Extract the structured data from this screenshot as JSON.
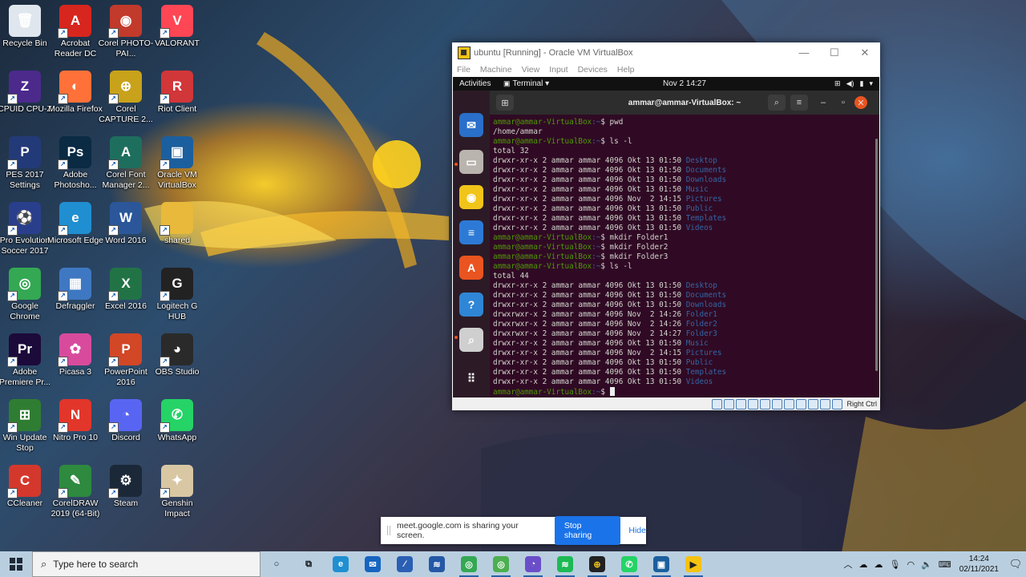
{
  "desktop_icons": [
    {
      "label": "Recycle Bin",
      "icon": "recycle-bin-icon",
      "color": "#dfe6ee",
      "glyph": "🗑"
    },
    {
      "label": "Acrobat Reader DC",
      "icon": "acrobat-icon",
      "color": "#d7261e",
      "glyph": "A"
    },
    {
      "label": "Corel PHOTO-PAI...",
      "icon": "corel-photopaint-icon",
      "color": "#c23a2b",
      "glyph": "◉"
    },
    {
      "label": "VALORANT",
      "icon": "valorant-icon",
      "color": "#ff4655",
      "glyph": "V"
    },
    {
      "label": "CPUID CPU-Z",
      "icon": "cpuz-icon",
      "color": "#4b2a8c",
      "glyph": "Z"
    },
    {
      "label": "Mozilla Firefox",
      "icon": "firefox-icon",
      "color": "#ff7139",
      "glyph": "◐"
    },
    {
      "label": "Corel CAPTURE 2...",
      "icon": "corel-capture-icon",
      "color": "#c8a21a",
      "glyph": "⊕"
    },
    {
      "label": "Riot Client",
      "icon": "riot-client-icon",
      "color": "#d13639",
      "glyph": "R"
    },
    {
      "label": "PES 2017 Settings",
      "icon": "pes-settings-icon",
      "color": "#233a78",
      "glyph": "P"
    },
    {
      "label": "Adobe Photosho...",
      "icon": "photoshop-icon",
      "color": "#0b2a43",
      "glyph": "Ps"
    },
    {
      "label": "Corel Font Manager 2...",
      "icon": "corel-font-manager-icon",
      "color": "#1e6e5e",
      "glyph": "A"
    },
    {
      "label": "Oracle VM VirtualBox",
      "icon": "virtualbox-icon",
      "color": "#1c5f9e",
      "glyph": "▣"
    },
    {
      "label": "Pro Evolution Soccer 2017",
      "icon": "pes-icon",
      "color": "#2a3f8c",
      "glyph": "⚽"
    },
    {
      "label": "Microsoft Edge",
      "icon": "edge-icon",
      "color": "#1f8fd1",
      "glyph": "e"
    },
    {
      "label": "Word 2016",
      "icon": "word-icon",
      "color": "#2b579a",
      "glyph": "W"
    },
    {
      "label": "shared",
      "icon": "folder-icon",
      "color": "#e8b93a",
      "glyph": ""
    },
    {
      "label": "Google Chrome",
      "icon": "chrome-icon",
      "color": "#34a853",
      "glyph": "◎"
    },
    {
      "label": "Defraggler",
      "icon": "defraggler-icon",
      "color": "#3f78c2",
      "glyph": "▦"
    },
    {
      "label": "Excel 2016",
      "icon": "excel-icon",
      "color": "#217346",
      "glyph": "X"
    },
    {
      "label": "Logitech G HUB",
      "icon": "logitech-ghub-icon",
      "color": "#222222",
      "glyph": "G"
    },
    {
      "label": "Adobe Premiere Pr...",
      "icon": "premiere-icon",
      "color": "#1c0a3a",
      "glyph": "Pr"
    },
    {
      "label": "Picasa 3",
      "icon": "picasa-icon",
      "color": "#d84b9c",
      "glyph": "✿"
    },
    {
      "label": "PowerPoint 2016",
      "icon": "powerpoint-icon",
      "color": "#d24726",
      "glyph": "P"
    },
    {
      "label": "OBS Studio",
      "icon": "obs-icon",
      "color": "#2a2a2a",
      "glyph": "◕"
    },
    {
      "label": "Win Update Stop",
      "icon": "win-update-stop-icon",
      "color": "#2f7d32",
      "glyph": "⊞"
    },
    {
      "label": "Nitro Pro 10",
      "icon": "nitro-icon",
      "color": "#e2362b",
      "glyph": "N"
    },
    {
      "label": "Discord",
      "icon": "discord-icon",
      "color": "#5865f2",
      "glyph": "◔"
    },
    {
      "label": "WhatsApp",
      "icon": "whatsapp-icon",
      "color": "#25d366",
      "glyph": "✆"
    },
    {
      "label": "CCleaner",
      "icon": "ccleaner-icon",
      "color": "#d4382c",
      "glyph": "C"
    },
    {
      "label": "CorelDRAW 2019 (64-Bit)",
      "icon": "coreldraw-icon",
      "color": "#2d8a3e",
      "glyph": "✎"
    },
    {
      "label": "Steam",
      "icon": "steam-icon",
      "color": "#1b2838",
      "glyph": "⚙"
    },
    {
      "label": "Genshin Impact",
      "icon": "genshin-icon",
      "color": "#d9c7a3",
      "glyph": "✦"
    }
  ],
  "vbox": {
    "title": "ubuntu [Running] - Oracle VM VirtualBox",
    "menu": [
      "File",
      "Machine",
      "View",
      "Input",
      "Devices",
      "Help"
    ],
    "status_key": "Right Ctrl"
  },
  "gnome": {
    "activities": "Activities",
    "app": "Terminal ▾",
    "clock": "Nov 2  14:27"
  },
  "terminal": {
    "title": "ammar@ammar-VirtualBox: ~",
    "prompt_user": "ammar@ammar-VirtualBox",
    "prompt_path": ":~",
    "lines": [
      {
        "kind": "cmd",
        "text": "$ pwd"
      },
      {
        "kind": "out",
        "text": "/home/ammar"
      },
      {
        "kind": "cmd",
        "text": "$ ls -l"
      },
      {
        "kind": "out",
        "text": "total 32"
      },
      {
        "kind": "ls",
        "text": "drwxr-xr-x 2 ammar ammar 4096 Okt 13 01:50 ",
        "name": "Desktop"
      },
      {
        "kind": "ls",
        "text": "drwxr-xr-x 2 ammar ammar 4096 Okt 13 01:50 ",
        "name": "Documents"
      },
      {
        "kind": "ls",
        "text": "drwxr-xr-x 2 ammar ammar 4096 Okt 13 01:50 ",
        "name": "Downloads"
      },
      {
        "kind": "ls",
        "text": "drwxr-xr-x 2 ammar ammar 4096 Okt 13 01:50 ",
        "name": "Music"
      },
      {
        "kind": "ls",
        "text": "drwxr-xr-x 2 ammar ammar 4096 Nov  2 14:15 ",
        "name": "Pictures"
      },
      {
        "kind": "ls",
        "text": "drwxr-xr-x 2 ammar ammar 4096 Okt 13 01:50 ",
        "name": "Public"
      },
      {
        "kind": "ls",
        "text": "drwxr-xr-x 2 ammar ammar 4096 Okt 13 01:50 ",
        "name": "Templates"
      },
      {
        "kind": "ls",
        "text": "drwxr-xr-x 2 ammar ammar 4096 Okt 13 01:50 ",
        "name": "Videos"
      },
      {
        "kind": "cmd",
        "text": "$ mkdir Folder1"
      },
      {
        "kind": "cmd",
        "text": "$ mkdir Folder2"
      },
      {
        "kind": "cmd",
        "text": "$ mkdir Folder3"
      },
      {
        "kind": "cmd",
        "text": "$ ls -l"
      },
      {
        "kind": "out",
        "text": "total 44"
      },
      {
        "kind": "ls",
        "text": "drwxr-xr-x 2 ammar ammar 4096 Okt 13 01:50 ",
        "name": "Desktop"
      },
      {
        "kind": "ls",
        "text": "drwxr-xr-x 2 ammar ammar 4096 Okt 13 01:50 ",
        "name": "Documents"
      },
      {
        "kind": "ls",
        "text": "drwxr-xr-x 2 ammar ammar 4096 Okt 13 01:50 ",
        "name": "Downloads"
      },
      {
        "kind": "ls",
        "text": "drwxrwxr-x 2 ammar ammar 4096 Nov  2 14:26 ",
        "name": "Folder1"
      },
      {
        "kind": "ls",
        "text": "drwxrwxr-x 2 ammar ammar 4096 Nov  2 14:26 ",
        "name": "Folder2"
      },
      {
        "kind": "ls",
        "text": "drwxrwxr-x 2 ammar ammar 4096 Nov  2 14:27 ",
        "name": "Folder3"
      },
      {
        "kind": "ls",
        "text": "drwxr-xr-x 2 ammar ammar 4096 Okt 13 01:50 ",
        "name": "Music"
      },
      {
        "kind": "ls",
        "text": "drwxr-xr-x 2 ammar ammar 4096 Nov  2 14:15 ",
        "name": "Pictures"
      },
      {
        "kind": "ls",
        "text": "drwxr-xr-x 2 ammar ammar 4096 Okt 13 01:50 ",
        "name": "Public"
      },
      {
        "kind": "ls",
        "text": "drwxr-xr-x 2 ammar ammar 4096 Okt 13 01:50 ",
        "name": "Templates"
      },
      {
        "kind": "ls",
        "text": "drwxr-xr-x 2 ammar ammar 4096 Okt 13 01:50 ",
        "name": "Videos"
      },
      {
        "kind": "cursor",
        "text": "$ "
      }
    ]
  },
  "dock": [
    {
      "icon": "thunderbird-icon",
      "color": "#2a6fc9",
      "glyph": "✉"
    },
    {
      "icon": "files-icon",
      "color": "#b9b4ad",
      "glyph": "▭"
    },
    {
      "icon": "rhythmbox-icon",
      "color": "#f0c419",
      "glyph": "◉"
    },
    {
      "icon": "writer-icon",
      "color": "#2d7ad6",
      "glyph": "≡"
    },
    {
      "icon": "software-icon",
      "color": "#e95420",
      "glyph": "A"
    },
    {
      "icon": "help-icon",
      "color": "#2f86d6",
      "glyph": "?"
    },
    {
      "icon": "screenshot-icon",
      "color": "#cfcfcf",
      "glyph": "⌕"
    },
    {
      "icon": "show-apps-icon",
      "color": "#2c1b26",
      "glyph": "⠿"
    }
  ],
  "sharebar": {
    "text": "meet.google.com is sharing your screen.",
    "stop": "Stop sharing",
    "hide": "Hide"
  },
  "taskbar": {
    "search_placeholder": "Type here to search",
    "apps": [
      {
        "icon": "cortana-icon",
        "color": "#b9cfe0",
        "glyph": "○",
        "fg": "#111"
      },
      {
        "icon": "task-view-icon",
        "color": "#b9cfe0",
        "glyph": "⧉",
        "fg": "#111"
      },
      {
        "icon": "edge-icon",
        "color": "#1f8fd1",
        "glyph": "e",
        "fg": "#fff"
      },
      {
        "icon": "mail-icon",
        "color": "#1565c0",
        "glyph": "✉",
        "fg": "#fff"
      },
      {
        "icon": "vs-code-icon",
        "color": "#2b5fb3",
        "glyph": "⁄",
        "fg": "#fff"
      },
      {
        "icon": "powershell-icon",
        "color": "#2458a6",
        "glyph": "≋",
        "fg": "#fff"
      },
      {
        "icon": "chrome-icon",
        "color": "#34a853",
        "glyph": "◎",
        "fg": "#fff"
      },
      {
        "icon": "chrome-profile-icon",
        "color": "#4caf50",
        "glyph": "◎",
        "fg": "#fff"
      },
      {
        "icon": "messenger-icon",
        "color": "#6a4ec9",
        "glyph": "◔",
        "fg": "#fff"
      },
      {
        "icon": "spotify-icon",
        "color": "#1db954",
        "glyph": "≋",
        "fg": "#fff"
      },
      {
        "icon": "corel-capture-icon",
        "color": "#222222",
        "glyph": "⊕",
        "fg": "#f0c419"
      },
      {
        "icon": "whatsapp-icon",
        "color": "#25d366",
        "glyph": "✆",
        "fg": "#fff"
      },
      {
        "icon": "virtualbox-icon",
        "color": "#1c5f9e",
        "glyph": "▣",
        "fg": "#fff"
      },
      {
        "icon": "terminal-icon",
        "color": "#f5c211",
        "glyph": "▶",
        "fg": "#222"
      }
    ],
    "time": "14:24",
    "date": "02/11/2021"
  }
}
